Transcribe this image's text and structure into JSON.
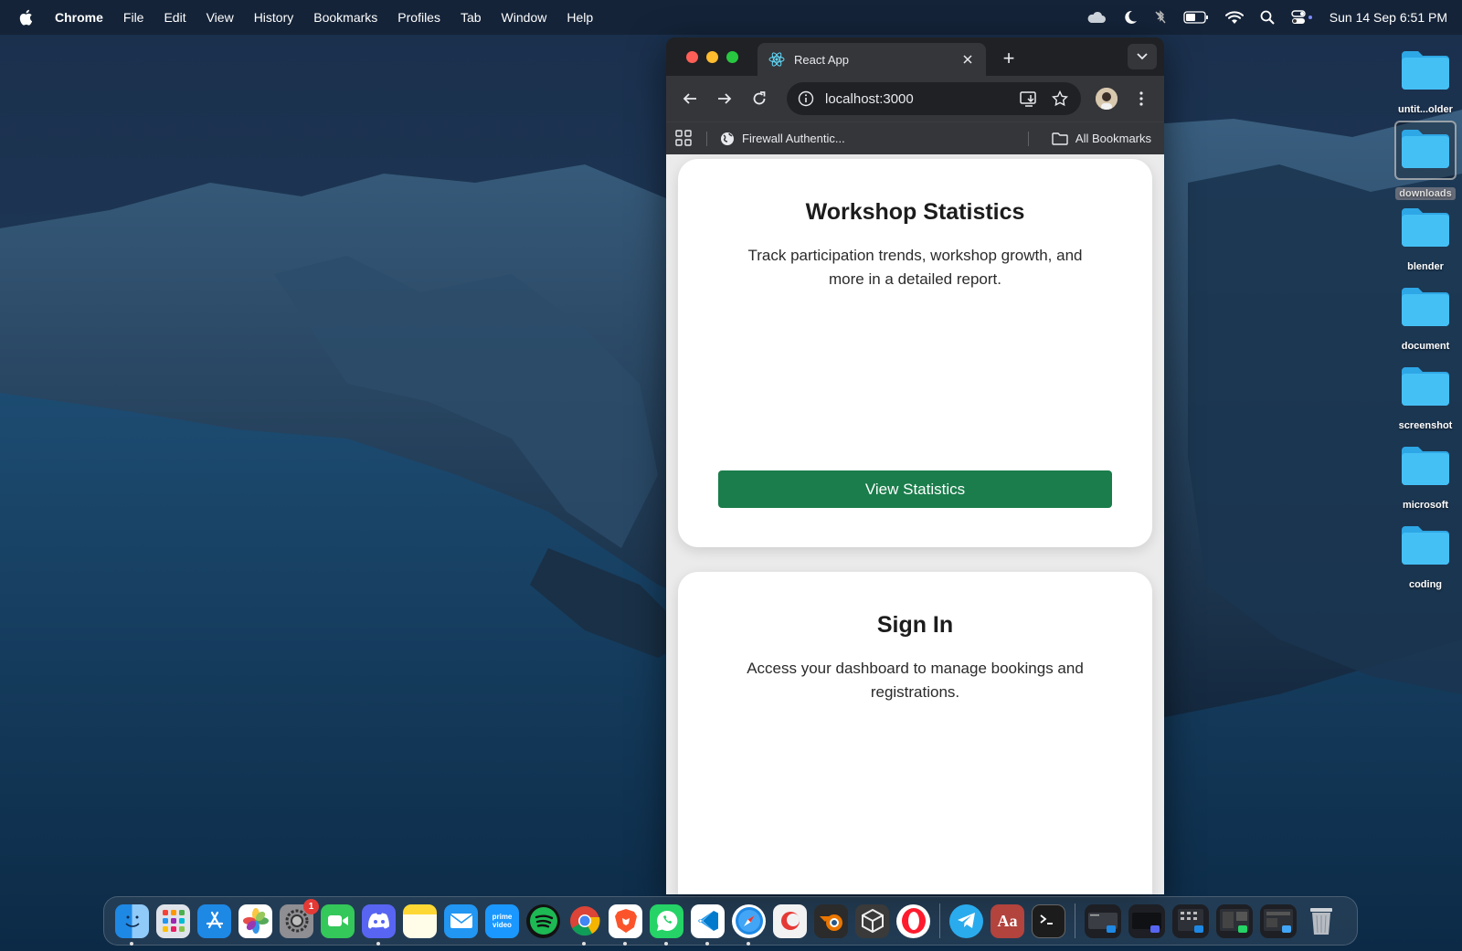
{
  "menubar": {
    "apple_icon": "apple-logo",
    "items": [
      "Chrome",
      "File",
      "Edit",
      "View",
      "History",
      "Bookmarks",
      "Profiles",
      "Tab",
      "Window",
      "Help"
    ],
    "status_icons": [
      "cloud-icon",
      "moon-icon",
      "bluetooth-off-icon",
      "battery-icon",
      "wifi-icon",
      "search-icon",
      "control-center-icon"
    ],
    "clock": "Sun 14 Sep  6:51 PM"
  },
  "desktop": {
    "folders": [
      "untit...older",
      "downloads",
      "blender",
      "document",
      "screenshot",
      "microsoft",
      "coding"
    ],
    "selected": "downloads",
    "folder_color": "#38b6f0"
  },
  "browser": {
    "tab_title": "React App",
    "new_tab_label": "+",
    "url": "localhost:3000",
    "bookmark_firewall": "Firewall Authentic...",
    "bookmark_all": "All Bookmarks"
  },
  "page": {
    "stats_card": {
      "title": "Workshop Statistics",
      "description": "Track participation trends, workshop growth, and more in a detailed report.",
      "button_label": "View Statistics"
    },
    "signin_card": {
      "title": "Sign In",
      "description": "Access your dashboard to manage bookings and registrations."
    },
    "accent_color": "#1a7d4b"
  },
  "dock": {
    "apps": [
      "Finder",
      "Launchpad",
      "App Store",
      "Photos",
      "System Settings",
      "FaceTime",
      "Discord",
      "Notes",
      "Mail",
      "Prime Video",
      "Spotify",
      "Chrome",
      "Brave",
      "WhatsApp",
      "VS Code",
      "Safari",
      "Toolbox",
      "Blender",
      "Unity",
      "Opera",
      "Telegram",
      "Dictionary",
      "Terminal"
    ],
    "settings_badge": "1",
    "prime_label": "prime video",
    "dictionary_label": "Aa"
  }
}
